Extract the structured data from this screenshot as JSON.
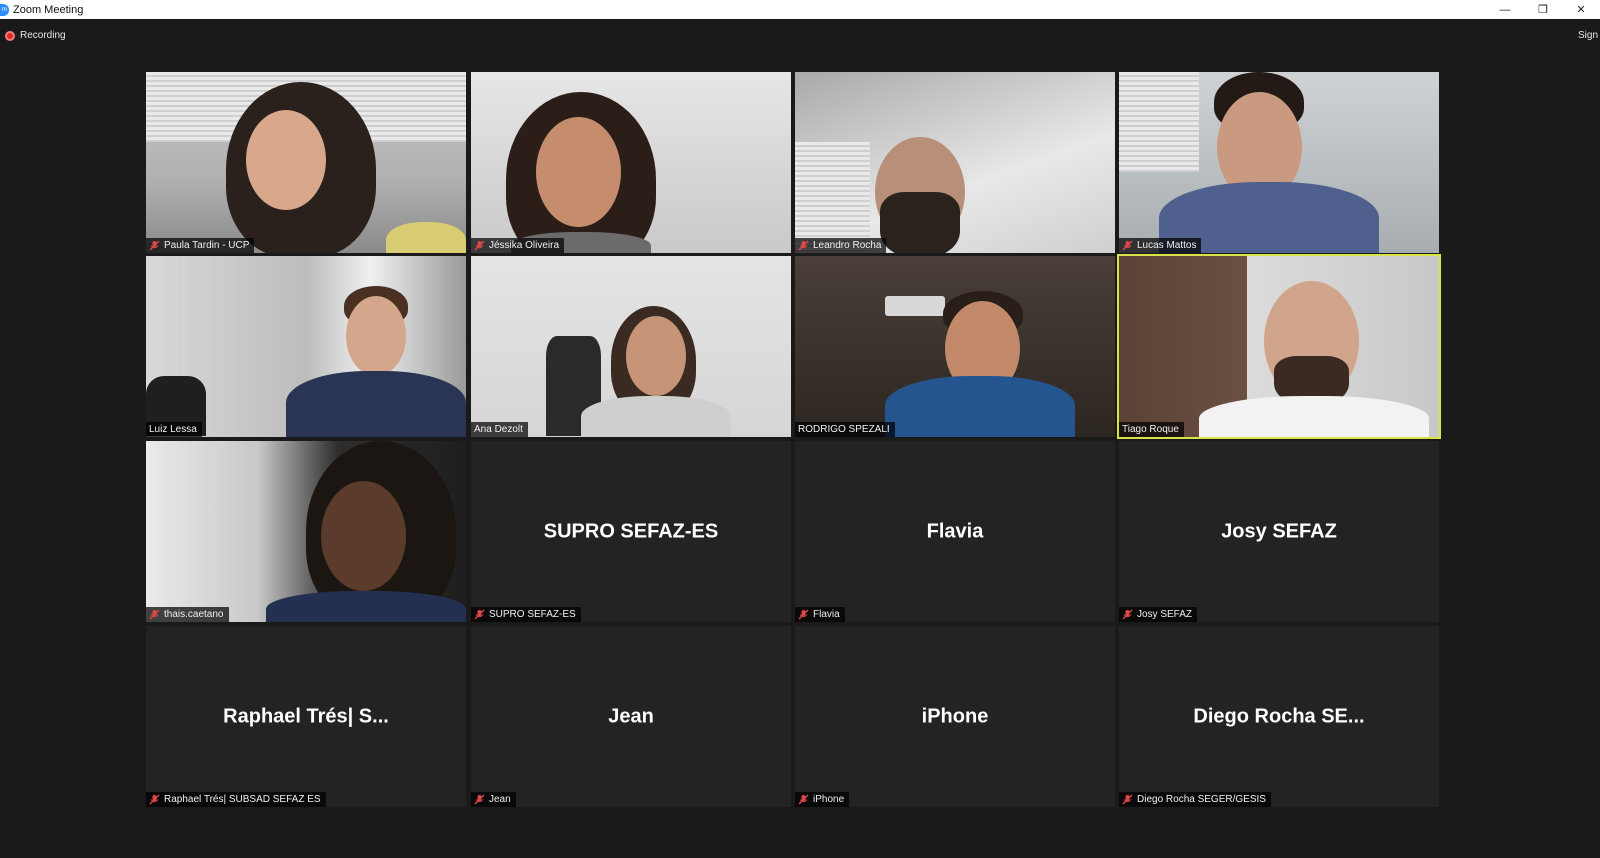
{
  "window": {
    "title": "Zoom Meeting",
    "controls": [
      "minimize",
      "restore",
      "close"
    ]
  },
  "recording": {
    "label": "Recording",
    "color": "#e02828"
  },
  "sign_in": {
    "label": "Sign"
  },
  "accent": {
    "active_speaker_border": "#d8e34a"
  },
  "participants": [
    {
      "name": "Paula Tardin - UCP",
      "muted": true,
      "video": true
    },
    {
      "name": "Jéssika Oliveira",
      "muted": true,
      "video": true
    },
    {
      "name": "Leandro Rocha",
      "muted": true,
      "video": true
    },
    {
      "name": "Lucas Mattos",
      "muted": true,
      "video": true
    },
    {
      "name": "Luiz Lessa",
      "muted": false,
      "video": true
    },
    {
      "name": "Ana Dezolt",
      "muted": false,
      "video": true
    },
    {
      "name": "RODRIGO SPEZALI",
      "muted": false,
      "video": true
    },
    {
      "name": "Tiago Roque",
      "muted": false,
      "video": true,
      "active_speaker": true
    },
    {
      "name": "thais.caetano",
      "muted": true,
      "video": true
    },
    {
      "name": "SUPRO SEFAZ-ES",
      "display": "SUPRO SEFAZ-ES",
      "muted": true,
      "video": false
    },
    {
      "name": "Flavia",
      "display": "Flavia",
      "muted": true,
      "video": false
    },
    {
      "name": "Josy SEFAZ",
      "display": "Josy SEFAZ",
      "muted": true,
      "video": false
    },
    {
      "name": "Raphael Trés| SUBSAD SEFAZ ES",
      "display": "Raphael Trés| S...",
      "muted": true,
      "video": false
    },
    {
      "name": "Jean",
      "display": "Jean",
      "muted": true,
      "video": false
    },
    {
      "name": "iPhone",
      "display": "iPhone",
      "muted": true,
      "video": false
    },
    {
      "name": "Diego Rocha SEGER/GESIS",
      "display": "Diego Rocha SE...",
      "muted": true,
      "video": false
    }
  ]
}
